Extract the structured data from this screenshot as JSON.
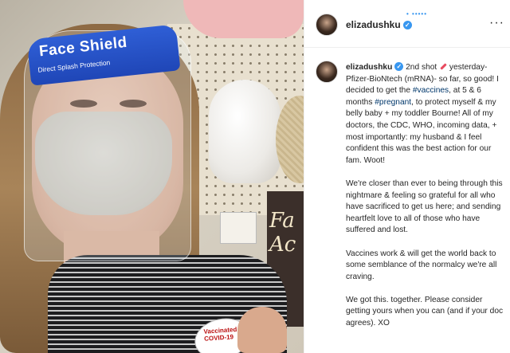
{
  "photo": {
    "shield_title": "Face Shield",
    "shield_subtitle": "Direct Splash Protection",
    "sticker_text": "Vaccinated for COVID-19",
    "sign_text": "Fa Ac"
  },
  "post": {
    "username": "elizadushku",
    "follow_label": "• •••••",
    "more_icon": "more-options-icon",
    "caption": {
      "p1_intro": " 2nd shot ",
      "p1_a": " yesterday- Pfizer-BioNtech (mRNA)- so far, so good! I decided to get the ",
      "tag_vaccines": "#vaccines",
      "p1_b": ", at 5 & 6 months ",
      "tag_pregnant": "#pregnant",
      "p1_c": ", to protect myself & my belly baby + my toddler Bourne! All of my doctors, the CDC, WHO, incoming data, + most importantly: my husband & I feel confident this was the best action for our fam. Woot!",
      "p2": "We're closer than ever to being through this nightmare & feeling so grateful for all who have sacrificed to get us here; and sending heartfelt love to all of those who have suffered and lost.",
      "p3": "Vaccines work & will get the world back to some semblance of the normalcy we're all craving.",
      "p4": "We got this. together. Please consider getting yours when you can (and if your doc agrees). XO"
    }
  },
  "colors": {
    "link_blue": "#3897f0",
    "hashtag": "#00376b",
    "verified": "#3897f0",
    "shield_band": "#1f46b7"
  }
}
